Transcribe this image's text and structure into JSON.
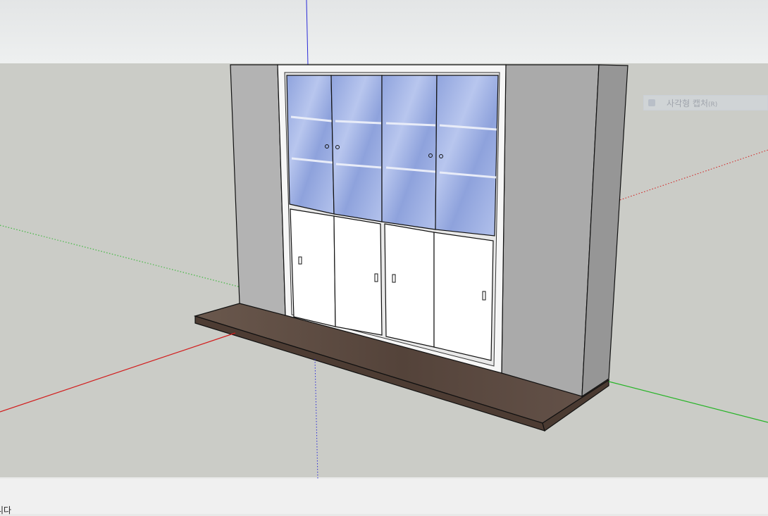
{
  "tooltip": {
    "label": "사각형 캡처",
    "shortcut": "(R)"
  },
  "status_bar": {
    "text": "니다"
  },
  "colors": {
    "x_axis": "#d21c1c",
    "y_axis": "#27b427",
    "z_axis": "#2a2ad8",
    "ground": "#cbccc7",
    "sky": "#e8eaeb",
    "glass": "#a4b6e6",
    "wood_base": "#5e4a3e",
    "side_panel": "#aaaaaa"
  },
  "icons": [
    "screen-capture-icon"
  ]
}
